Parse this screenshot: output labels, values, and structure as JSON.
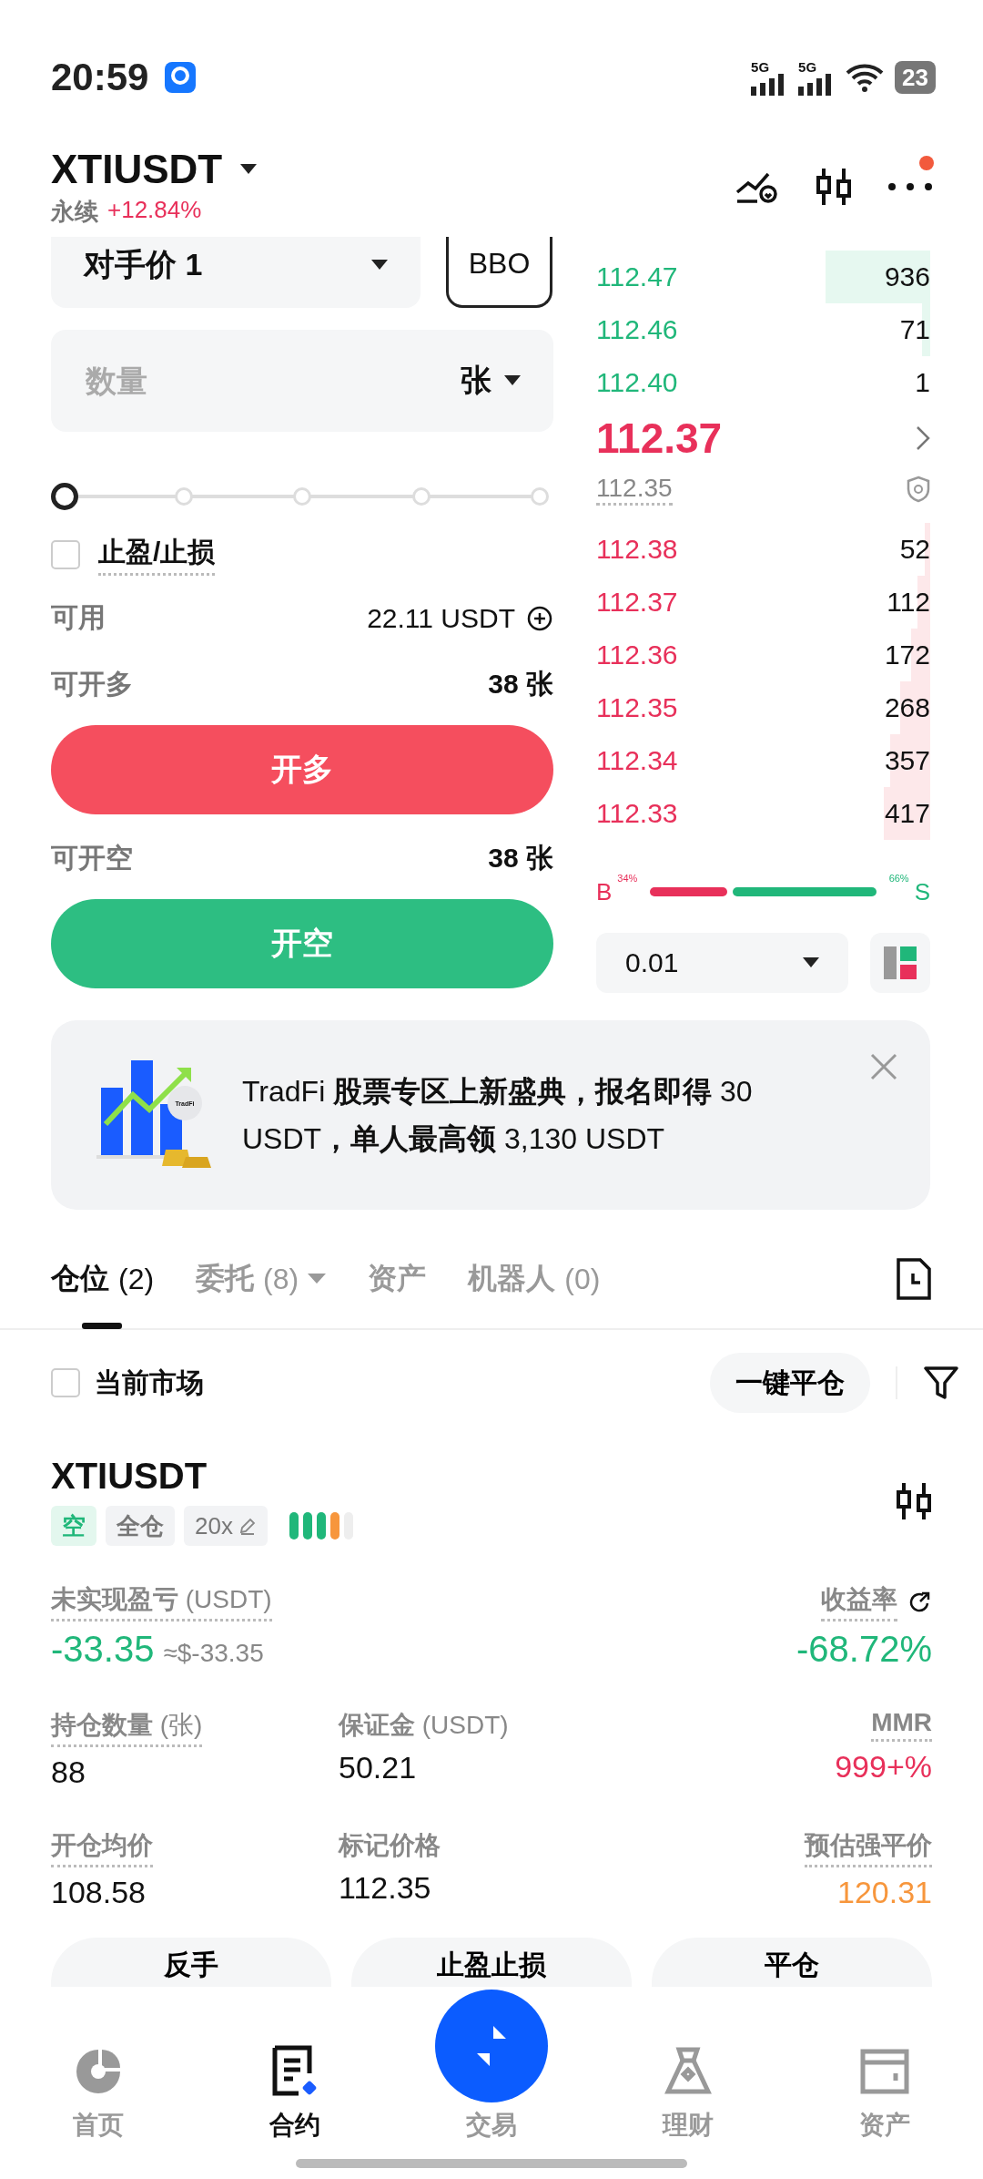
{
  "status_bar": {
    "time": "20:59",
    "networks": [
      "5G",
      "5G"
    ],
    "battery": "23"
  },
  "header": {
    "symbol": "XTIUSDT",
    "contract_type": "永续",
    "change": "+12.84%",
    "notification_dot": true
  },
  "order_form": {
    "price_type": "对手价 1",
    "bbo_button": "BBO",
    "quantity": {
      "placeholder": "数量",
      "unit": "张"
    },
    "slider": {
      "level": 0
    },
    "tp_sl": {
      "label": "止盈/止损",
      "checked": false
    },
    "available": {
      "label": "可用",
      "value": "22.11 USDT"
    },
    "long": {
      "label": "可开多",
      "value": "38 张",
      "button": "开多"
    },
    "short": {
      "label": "可开空",
      "value": "38 张",
      "button": "开空"
    }
  },
  "order_book": {
    "asks": [
      {
        "price": "112.47",
        "amount": "936"
      },
      {
        "price": "112.46",
        "amount": "71"
      },
      {
        "price": "112.40",
        "amount": "1"
      }
    ],
    "last_price": "112.37",
    "mark_price": "112.35",
    "bids": [
      {
        "price": "112.38",
        "amount": "52"
      },
      {
        "price": "112.37",
        "amount": "112"
      },
      {
        "price": "112.36",
        "amount": "172"
      },
      {
        "price": "112.35",
        "amount": "268"
      },
      {
        "price": "112.34",
        "amount": "357"
      },
      {
        "price": "112.33",
        "amount": "417"
      }
    ],
    "ratio": {
      "buy_label": "B",
      "buy_percent": "34%",
      "sell_percent": "66%",
      "sell_label": "S",
      "level": 0.34
    },
    "precision": "0.01"
  },
  "banner": {
    "text": "TradFi **股票专区上新盛典，报名即得** 30 USDT**，单人最高领** 3,130 USDT",
    "badge": "TradFi"
  },
  "tabs": [
    {
      "label": "仓位",
      "count": "(2)",
      "selected": true,
      "dropdown": false
    },
    {
      "label": "委托",
      "count": "(8)",
      "selected": false,
      "dropdown": true
    },
    {
      "label": "资产",
      "selected": false,
      "dropdown": false
    },
    {
      "label": "机器人",
      "count": "(0)",
      "selected": false,
      "dropdown": false
    }
  ],
  "filter_bar": {
    "current_market": {
      "label": "当前市场",
      "checked": false
    },
    "close_all": "一键平仓"
  },
  "position": {
    "symbol": "XTIUSDT",
    "side": "空",
    "margin_mode": "全仓",
    "leverage": "20x",
    "risk_bars": [
      {
        "color": "#20b77a"
      },
      {
        "color": "#20b77a"
      },
      {
        "color": "#20b77a"
      },
      {
        "color": "#f7963c"
      },
      {
        "color": "#eeeeee"
      }
    ],
    "pnl_label": "未实现盈亏",
    "pnl_unit": "(USDT)",
    "pnl": "-33.35",
    "pnl_usd": "≈$-33.35",
    "roe_label": "收益率",
    "roe": "-68.72%",
    "fields": [
      {
        "label": "持仓数量",
        "unit": "(张)",
        "value": "88",
        "color": "#111111",
        "underlined": true
      },
      {
        "label": "保证金",
        "unit": "(USDT)",
        "value": "50.21",
        "color": "#111111",
        "underlined": false
      },
      {
        "label": "MMR",
        "value": "999+%",
        "color": "#e8305a",
        "underlined": true
      },
      {
        "label": "开仓均价",
        "value": "108.58",
        "color": "#111111",
        "underlined": true
      },
      {
        "label": "标记价格",
        "value": "112.35",
        "color": "#111111",
        "underlined": false
      },
      {
        "label": "预估强平价",
        "value": "120.31",
        "color": "#f7963c",
        "underlined": true
      }
    ],
    "actions": [
      "反手",
      "止盈止损",
      "平仓"
    ]
  },
  "bottom_nav": [
    {
      "label": "首页",
      "kind": "home",
      "selected": false
    },
    {
      "label": "合约",
      "kind": "contract",
      "selected": true
    },
    {
      "label": "交易",
      "kind": "trade",
      "selected": false
    },
    {
      "label": "理财",
      "kind": "earn",
      "selected": false
    },
    {
      "label": "资产",
      "kind": "assets",
      "selected": false
    }
  ]
}
